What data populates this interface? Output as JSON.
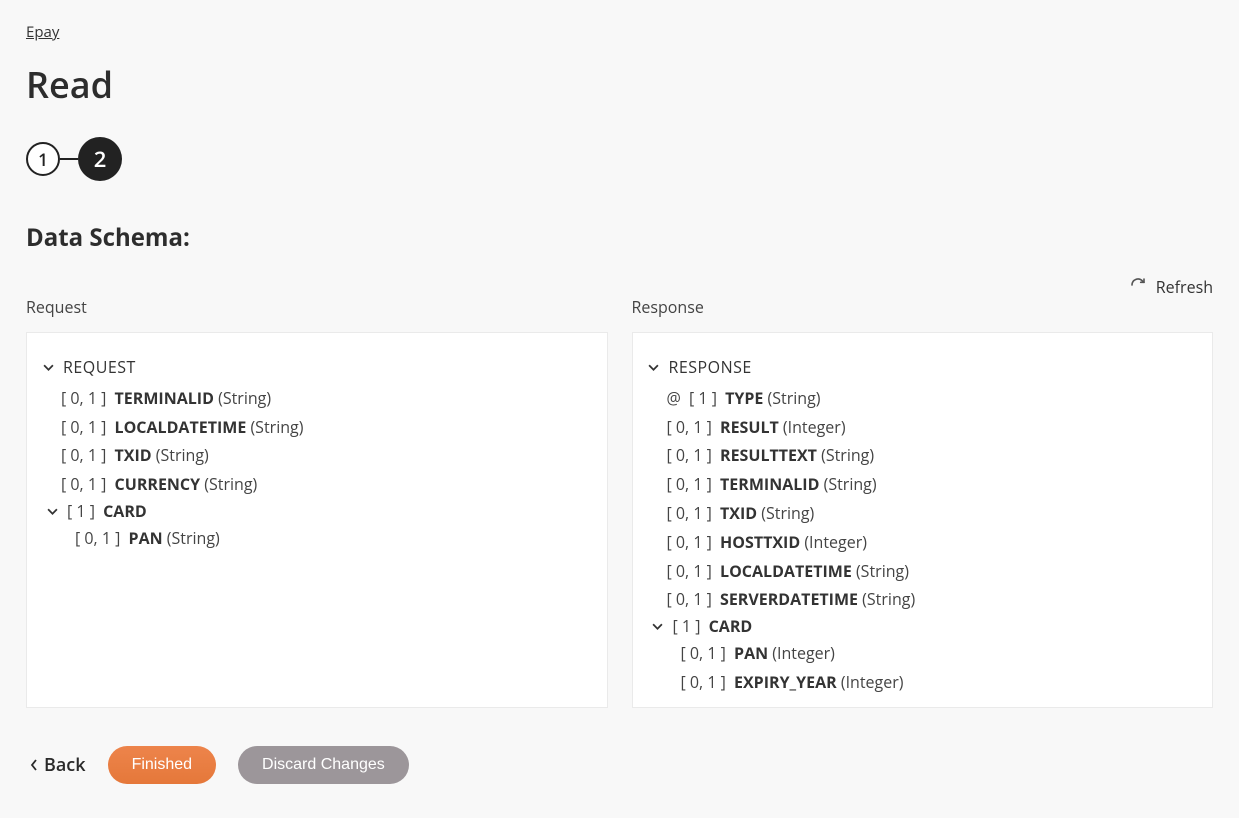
{
  "breadcrumb": "Epay",
  "title": "Read",
  "steps": {
    "s1": "1",
    "s2": "2"
  },
  "subtitle": "Data Schema:",
  "refresh": "Refresh",
  "request_label": "Request",
  "response_label": "Response",
  "request": {
    "root": "REQUEST",
    "fields": [
      {
        "occ": "[ 0, 1 ]",
        "name": "TERMINALID",
        "type": "(String)"
      },
      {
        "occ": "[ 0, 1 ]",
        "name": "LOCALDATETIME",
        "type": "(String)"
      },
      {
        "occ": "[ 0, 1 ]",
        "name": "TXID",
        "type": "(String)"
      },
      {
        "occ": "[ 0, 1 ]",
        "name": "CURRENCY",
        "type": "(String)"
      }
    ],
    "card": {
      "occ": "[ 1 ]",
      "name": "CARD"
    },
    "card_fields": [
      {
        "occ": "[ 0, 1 ]",
        "name": "PAN",
        "type": "(String)"
      }
    ]
  },
  "response": {
    "root": "RESPONSE",
    "attr": {
      "sym": "@",
      "occ": "[ 1 ]",
      "name": "TYPE",
      "type": "(String)"
    },
    "fields": [
      {
        "occ": "[ 0, 1 ]",
        "name": "RESULT",
        "type": "(Integer)"
      },
      {
        "occ": "[ 0, 1 ]",
        "name": "RESULTTEXT",
        "type": "(String)"
      },
      {
        "occ": "[ 0, 1 ]",
        "name": "TERMINALID",
        "type": "(String)"
      },
      {
        "occ": "[ 0, 1 ]",
        "name": "TXID",
        "type": "(String)"
      },
      {
        "occ": "[ 0, 1 ]",
        "name": "HOSTTXID",
        "type": "(Integer)"
      },
      {
        "occ": "[ 0, 1 ]",
        "name": "LOCALDATETIME",
        "type": "(String)"
      },
      {
        "occ": "[ 0, 1 ]",
        "name": "SERVERDATETIME",
        "type": "(String)"
      }
    ],
    "card": {
      "occ": "[ 1 ]",
      "name": "CARD"
    },
    "card_fields": [
      {
        "occ": "[ 0, 1 ]",
        "name": "PAN",
        "type": "(Integer)"
      },
      {
        "occ": "[ 0, 1 ]",
        "name": "EXPIRY_YEAR",
        "type": "(Integer)"
      }
    ]
  },
  "footer": {
    "back": "Back",
    "finished": "Finished",
    "discard": "Discard Changes"
  }
}
